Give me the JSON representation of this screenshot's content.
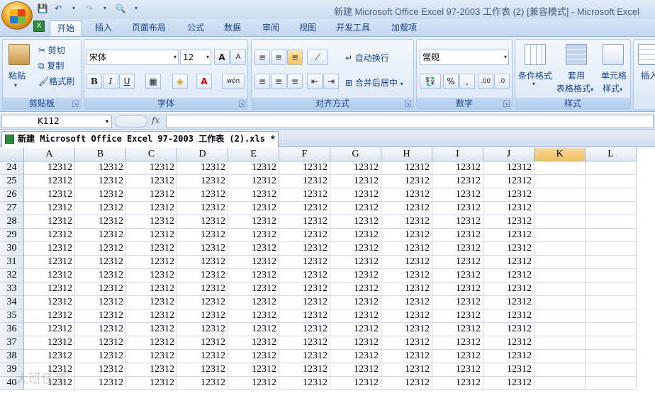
{
  "window": {
    "title": "新建 Microsoft Office Excel 97-2003 工作表 (2)  [兼容模式] - Microsoft Excel"
  },
  "quick_access": [
    "save-icon",
    "undo-icon",
    "redo-icon",
    "print-preview-icon"
  ],
  "tabs": [
    {
      "label": "开始",
      "active": true
    },
    {
      "label": "插入"
    },
    {
      "label": "页面布局"
    },
    {
      "label": "公式"
    },
    {
      "label": "数据"
    },
    {
      "label": "审阅"
    },
    {
      "label": "视图"
    },
    {
      "label": "开发工具"
    },
    {
      "label": "加载项"
    }
  ],
  "ribbon": {
    "clipboard": {
      "label": "剪贴板",
      "paste": "粘贴",
      "cut": "剪切",
      "copy": "复制",
      "format_painter": "格式刷"
    },
    "font": {
      "label": "字体",
      "font_name": "宋体",
      "font_size": "12",
      "grow": "A",
      "shrink": "A",
      "bold": "B",
      "italic": "I",
      "underline": "U",
      "color_a": "A",
      "phonetic": "wén"
    },
    "alignment": {
      "label": "对齐方式",
      "wrap": "自动换行",
      "merge": "合并后居中"
    },
    "number": {
      "label": "数字",
      "format": "常规",
      "percent": "%",
      "comma": ",",
      "inc_dec": ".00",
      "dec_dec": ".0"
    },
    "styles": {
      "label": "样式",
      "conditional": "条件格式",
      "table_format_1": "套用",
      "table_format_2": "表格格式",
      "cell_styles_1": "单元格",
      "cell_styles_2": "样式"
    },
    "cells": {
      "insert": "插入"
    }
  },
  "formula_bar": {
    "name_box": "K112",
    "fx": "fx",
    "value": ""
  },
  "workbook_tab": {
    "label": "新建 Microsoft Office Excel 97-2003 工作表 (2).xls *"
  },
  "sheet": {
    "columns": [
      "A",
      "B",
      "C",
      "D",
      "E",
      "F",
      "G",
      "H",
      "I",
      "J",
      "K",
      "L"
    ],
    "selected_column": "K",
    "rows": [
      24,
      25,
      26,
      27,
      28,
      29,
      30,
      31,
      32,
      33,
      34,
      35,
      36,
      37,
      38,
      39,
      40
    ],
    "filled_columns": 10,
    "cell_value": "12312"
  },
  "watermark": "大班任资"
}
